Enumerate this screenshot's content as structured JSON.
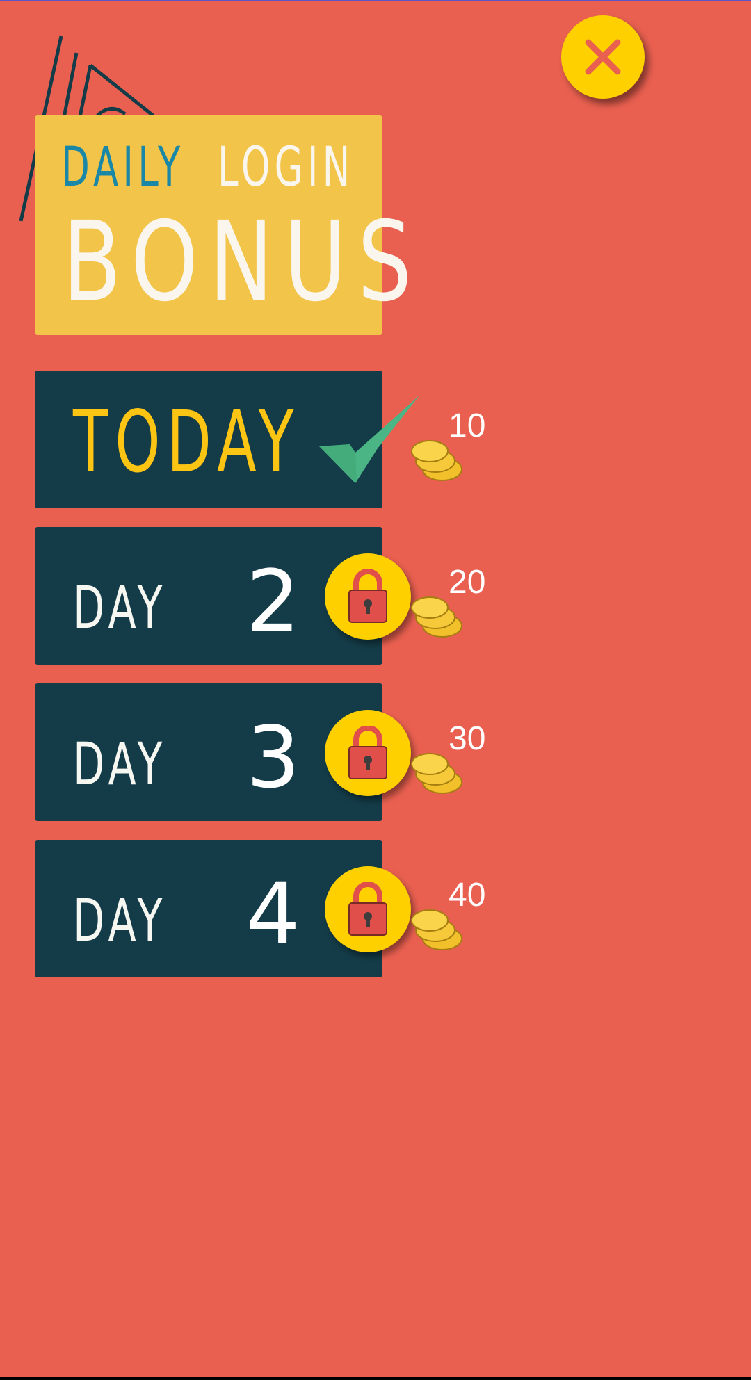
{
  "title": {
    "line1_word1": "DAILY",
    "line1_word2": "LOGIN",
    "line2": "BONUS"
  },
  "close_button": {
    "icon": "close-icon"
  },
  "days": [
    {
      "label": "TODAY",
      "number": "",
      "reward": "10",
      "status": "claimed",
      "status_icon": "checkmark-icon"
    },
    {
      "label": "DAY",
      "number": "2",
      "reward": "20",
      "status": "locked",
      "status_icon": "lock-icon"
    },
    {
      "label": "DAY",
      "number": "3",
      "reward": "30",
      "status": "locked",
      "status_icon": "lock-icon"
    },
    {
      "label": "DAY",
      "number": "4",
      "reward": "40",
      "status": "locked",
      "status_icon": "lock-icon"
    }
  ],
  "colors": {
    "background": "#e96050",
    "title_card": "#f2c54a",
    "day_card": "#143c48",
    "accent_yellow": "#fed000",
    "daily_blue": "#1a87a6",
    "check_green": "#4cb585",
    "lock_red": "#e04f4a"
  }
}
